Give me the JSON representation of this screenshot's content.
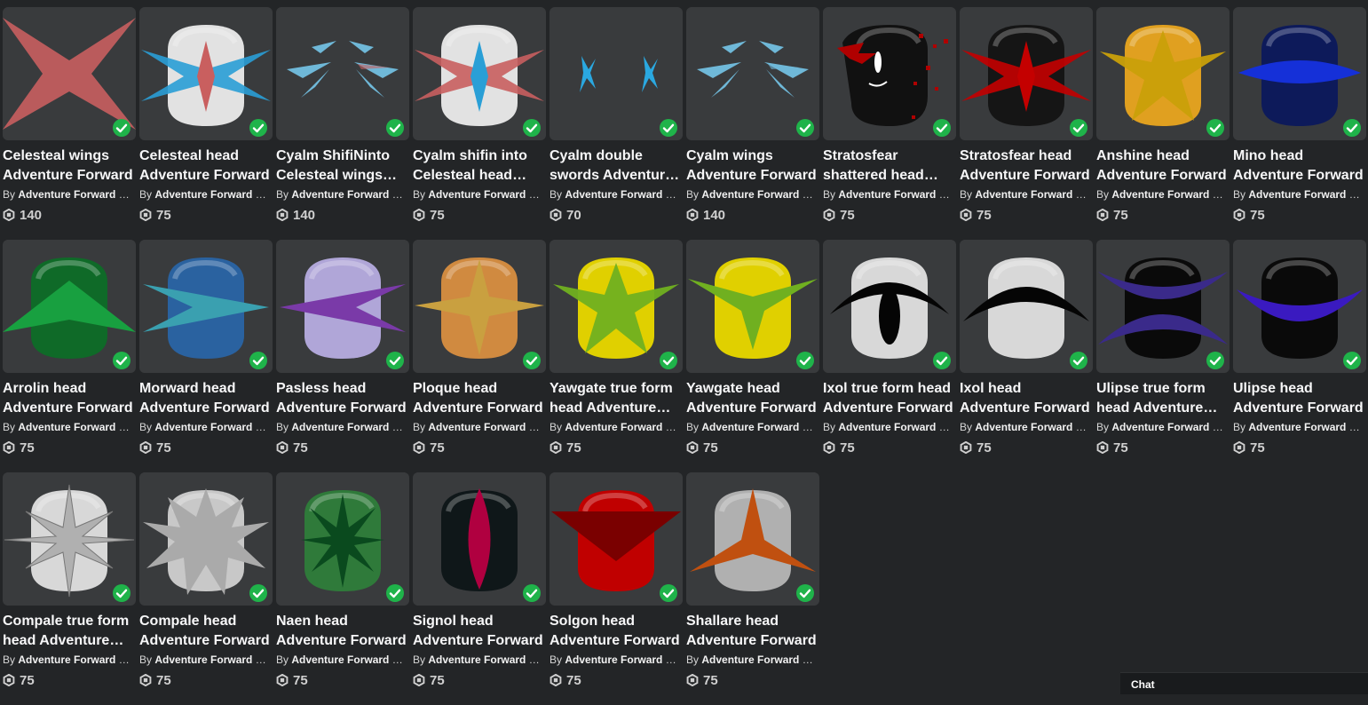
{
  "creator_prefix": "By",
  "items": [
    {
      "name": "Celesteal wings Adventure Forward",
      "creator": "Adventure Forward UGC",
      "price": "140",
      "art": "wings4",
      "colors": [
        "#c95f5f"
      ],
      "owned": true
    },
    {
      "name": "Celesteal head Adventure Forward",
      "creator": "Adventure Forward UGC",
      "price": "75",
      "art": "head_x",
      "colors": [
        "#e2e2e2",
        "#c95f5f",
        "#2a9fd6"
      ],
      "owned": true
    },
    {
      "name": "Cyalm ShifiNinto Celesteal wings Adventure Forward",
      "creator": "Adventure Forward UGC",
      "price": "140",
      "art": "shards",
      "colors": [
        "#6fb8d8",
        "#c95f5f"
      ],
      "owned": true
    },
    {
      "name": "Cyalm shifin into Celesteal head Adventure Forward",
      "creator": "Adventure Forward UGC",
      "price": "75",
      "art": "head_x",
      "colors": [
        "#e2e2e2",
        "#2a9fd6",
        "#c95f5f"
      ],
      "owned": true
    },
    {
      "name": "Cyalm double swords Adventure Forward",
      "creator": "Adventure Forward UGC",
      "price": "70",
      "art": "swords",
      "colors": [
        "#2aa8e0"
      ],
      "owned": true
    },
    {
      "name": "Cyalm wings Adventure Forward",
      "creator": "Adventure Forward UGC",
      "price": "140",
      "art": "shards",
      "colors": [
        "#6fb8d8",
        "#6fb8d8"
      ],
      "owned": true
    },
    {
      "name": "Stratosfear shattered head Adventure Forward",
      "creator": "Adventure Forward UGC",
      "price": "75",
      "art": "face",
      "colors": [
        "#111111",
        "#b00000"
      ],
      "owned": true
    },
    {
      "name": "Stratosfear head Adventure Forward",
      "creator": "Adventure Forward UGC",
      "price": "75",
      "art": "head_x",
      "colors": [
        "#151515",
        "#c40000",
        "#c40000"
      ],
      "owned": true
    },
    {
      "name": "Anshine head Adventure Forward",
      "creator": "Adventure Forward UGC",
      "price": "75",
      "art": "head_star",
      "colors": [
        "#e0a020",
        "#c9a00a"
      ],
      "owned": true
    },
    {
      "name": "Mino head Adventure Forward",
      "creator": "Adventure Forward UGC",
      "price": "75",
      "art": "head_band",
      "colors": [
        "#0d1a5a",
        "#1530d8"
      ],
      "owned": true
    },
    {
      "name": "Arrolin head Adventure Forward",
      "creator": "Adventure Forward UGC",
      "price": "75",
      "art": "head_arrow",
      "colors": [
        "#0f6a28",
        "#18a040"
      ],
      "owned": true
    },
    {
      "name": "Morward head Adventure Forward",
      "creator": "Adventure Forward UGC",
      "price": "75",
      "art": "head_right",
      "colors": [
        "#2a62a0",
        "#3aa0b0"
      ],
      "owned": true
    },
    {
      "name": "Pasless head Adventure Forward",
      "creator": "Adventure Forward UGC",
      "price": "75",
      "art": "head_left",
      "colors": [
        "#b0a6d8",
        "#7a3aa8"
      ],
      "owned": true
    },
    {
      "name": "Ploque head Adventure Forward",
      "creator": "Adventure Forward UGC",
      "price": "75",
      "art": "head_star4",
      "colors": [
        "#d08a40",
        "#c9a040"
      ],
      "owned": true
    },
    {
      "name": "Yawgate true form head Adventure Forward",
      "creator": "Adventure Forward UGC",
      "price": "75",
      "art": "head_star",
      "colors": [
        "#e0d000",
        "#70b020"
      ],
      "owned": true
    },
    {
      "name": "Yawgate head Adventure Forward",
      "creator": "Adventure Forward UGC",
      "price": "75",
      "art": "head_y",
      "colors": [
        "#e0d000",
        "#70b020"
      ],
      "owned": true
    },
    {
      "name": "Ixol true form head Adventure Forward",
      "creator": "Adventure Forward UGC",
      "price": "75",
      "art": "head_eye",
      "colors": [
        "#d8d8d8",
        "#050505"
      ],
      "owned": true
    },
    {
      "name": "Ixol head Adventure Forward",
      "creator": "Adventure Forward UGC",
      "price": "75",
      "art": "head_brow",
      "colors": [
        "#d8d8d8",
        "#050505"
      ],
      "owned": true
    },
    {
      "name": "Ulipse true form head Adventure Forward",
      "creator": "Adventure Forward UGC",
      "price": "75",
      "art": "head_ulipse2",
      "colors": [
        "#0a0a0a",
        "#3a2a8a"
      ],
      "owned": true
    },
    {
      "name": "Ulipse head Adventure Forward",
      "creator": "Adventure Forward UGC",
      "price": "75",
      "art": "head_ulipse1",
      "colors": [
        "#0a0a0a",
        "#3a1ac0"
      ],
      "owned": true
    },
    {
      "name": "Compale true form head Adventure Forward",
      "creator": "Adventure Forward UGC",
      "price": "75",
      "art": "head_compass",
      "colors": [
        "#d8d8d8",
        "#b0b0b0"
      ],
      "owned": true
    },
    {
      "name": "Compale head Adventure Forward",
      "creator": "Adventure Forward UGC",
      "price": "75",
      "art": "head_burst",
      "colors": [
        "#c8c8c8",
        "#aaaaaa"
      ],
      "owned": true
    },
    {
      "name": "Naen head Adventure Forward",
      "creator": "Adventure Forward UGC",
      "price": "75",
      "art": "head_naen",
      "colors": [
        "#2f7a3a",
        "#0a4a1e"
      ],
      "owned": true
    },
    {
      "name": "Signol head Adventure Forward",
      "creator": "Adventure Forward UGC",
      "price": "75",
      "art": "head_lens",
      "colors": [
        "#0f1719",
        "#b00040"
      ],
      "owned": true
    },
    {
      "name": "Solgon head Adventure Forward",
      "creator": "Adventure Forward UGC",
      "price": "75",
      "art": "head_v",
      "colors": [
        "#c00000",
        "#7a0000"
      ],
      "owned": true
    },
    {
      "name": "Shallare head Adventure Forward",
      "creator": "Adventure Forward UGC",
      "price": "75",
      "art": "head_tri",
      "colors": [
        "#b0b0b0",
        "#c05010"
      ],
      "owned": true
    }
  ],
  "chat": {
    "label": "Chat"
  },
  "theme": {
    "check_color": "#1fb34a",
    "robux_color": "#cfcfcf"
  }
}
